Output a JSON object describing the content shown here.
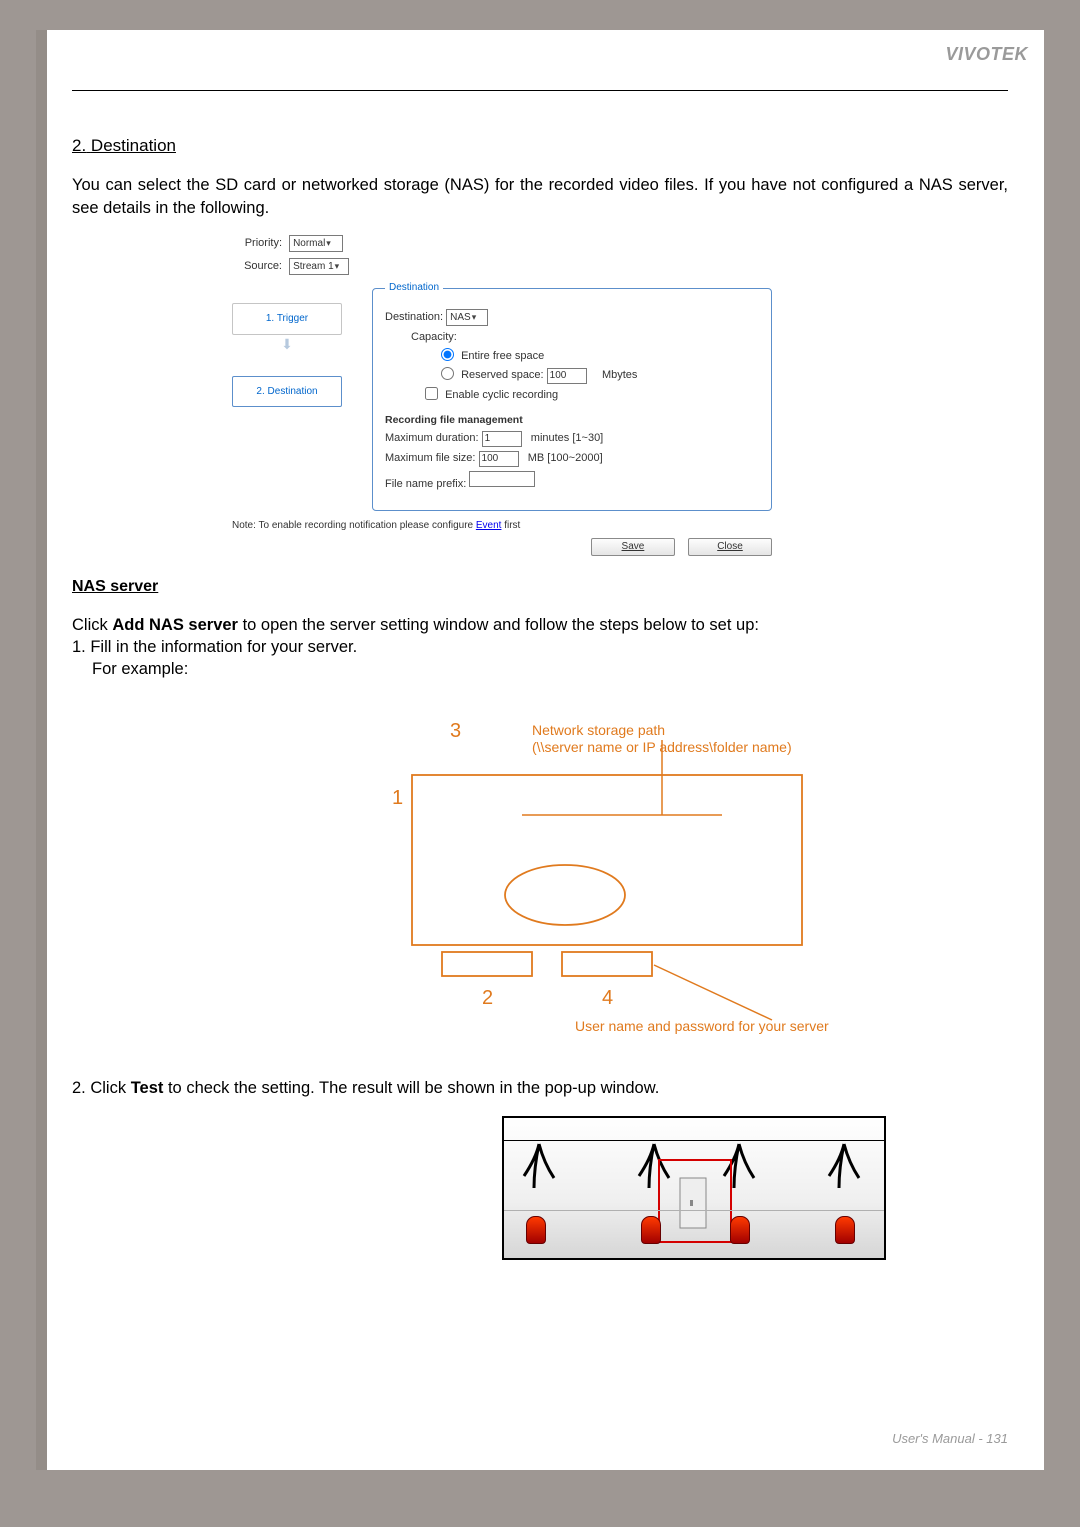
{
  "brand": "VIVOTEK",
  "section": {
    "number": "2.",
    "title": "Destination",
    "paragraph": "You can select the SD card or networked storage (NAS) for the recorded video files. If you have not configured a NAS server, see details in the following."
  },
  "config_panel": {
    "priority_label": "Priority:",
    "priority_value": "Normal",
    "source_label": "Source:",
    "source_value": "Stream 1",
    "steps": {
      "trigger": "1.  Trigger",
      "destination": "2.  Destination"
    },
    "fieldset_legend": "Destination",
    "dest_label": "Destination:",
    "dest_value": "NAS",
    "capacity_label": "Capacity:",
    "radio_entire": "Entire free space",
    "radio_reserved": "Reserved space:",
    "reserved_value": "100",
    "reserved_unit": "Mbytes",
    "cyclic_label": "Enable cyclic recording",
    "mgmt_heading": "Recording file management",
    "max_dur_label": "Maximum duration:",
    "max_dur_value": "1",
    "max_dur_unit": "minutes [1~30]",
    "max_size_label": "Maximum file size:",
    "max_size_value": "100",
    "max_size_unit": "MB [100~2000]",
    "prefix_label": "File name prefix:",
    "note_pre": "Note: To enable recording notification please configure ",
    "note_link": "Event",
    "note_post": " first",
    "save_btn": "Save",
    "close_btn": "Close"
  },
  "nas": {
    "heading": "NAS server",
    "intro_pre": "Click ",
    "intro_bold": "Add NAS server",
    "intro_post": " to open the server setting window and follow the steps below to set up:",
    "step1_a": "1. Fill in the information for your server.",
    "step1_b": "For example:",
    "diagram": {
      "m1": "1",
      "m2": "2",
      "m3": "3",
      "m4": "4",
      "label_path_a": "Network storage path",
      "label_path_b": "(\\\\server name or IP address\\folder name)",
      "label_auth": "User name and password for your server"
    },
    "step2_pre": "2. Click ",
    "step2_bold": "Test",
    "step2_post": " to check the setting. The result will be shown in the pop-up window."
  },
  "footer": {
    "title": "User's Manual - ",
    "page": "131"
  }
}
